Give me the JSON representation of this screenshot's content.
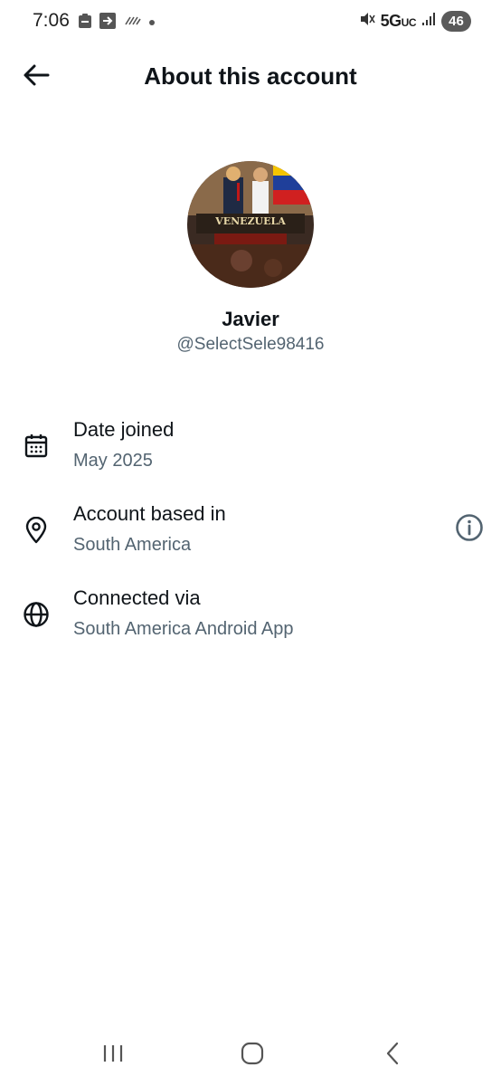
{
  "status_bar": {
    "time": "7:06",
    "network": "5G",
    "network_suffix": "UC",
    "battery": "46",
    "icons": [
      "clipboard-icon",
      "forward-box-icon",
      "nfc-stripe-icon",
      "dot-icon",
      "mute-vibrate-icon",
      "signal-icon"
    ]
  },
  "header": {
    "title": "About this account",
    "back_icon": "arrow-left-icon"
  },
  "profile": {
    "display_name": "Javier",
    "handle": "@SelectSele98416",
    "avatar_text": "VENEZUELA"
  },
  "rows": [
    {
      "icon": "calendar-icon",
      "label": "Date joined",
      "value": "May 2025"
    },
    {
      "icon": "location-pin-icon",
      "label": "Account based in",
      "value": "South America",
      "action_icon": "info-icon"
    },
    {
      "icon": "globe-icon",
      "label": "Connected via",
      "value": "South America Android App"
    }
  ],
  "nav_bar": {
    "icons": [
      "recents-icon",
      "home-icon",
      "back-icon"
    ]
  },
  "colors": {
    "text_primary": "#0f1419",
    "text_secondary": "#536471",
    "background": "#ffffff"
  }
}
